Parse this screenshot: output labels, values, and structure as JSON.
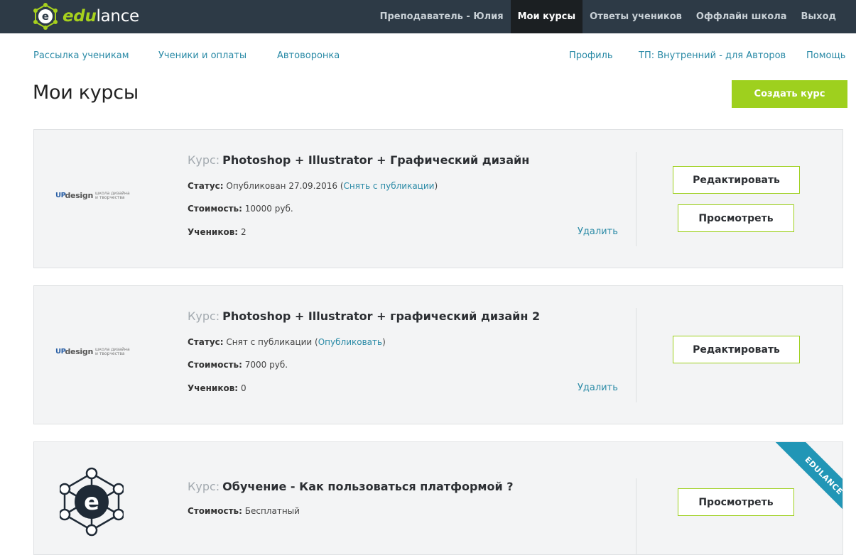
{
  "brand": {
    "logo_part1": "edu",
    "logo_part2": "lance"
  },
  "topnav": {
    "teacher": "Преподаватель - Юлия",
    "my_courses": "Мои курсы",
    "answers": "Ответы учеников",
    "offline": "Оффлайн школа",
    "logout": "Выход"
  },
  "subnav": {
    "mailing": "Рассылка ученикам",
    "students": "Ученики и оплаты",
    "autofunnel": "Автоворонка",
    "profile": "Профиль",
    "tariff": "ТП: Внутренний - для Авторов",
    "help": "Помощь"
  },
  "page": {
    "title": "Мои курсы",
    "create_button": "Создать курс"
  },
  "labels": {
    "course": "Курс:",
    "status": "Статус:",
    "price": "Стоимость:",
    "students": "Учеников:",
    "delete": "Удалить",
    "edit": "Редактировать",
    "view": "Просмотреть"
  },
  "courses": [
    {
      "title": "Photoshop + Illustrator + Графический дизайн",
      "thumb_brand": {
        "up": "UP",
        "design": "design",
        "sub": "школа дизайна и творчества"
      },
      "status_text": "Опубликован 27.09.2016 (",
      "status_link": "Снять с публикации",
      "status_close": ")",
      "price": "10000 руб.",
      "students": "2"
    },
    {
      "title": "Photoshop + Illustrator + графический дизайн 2",
      "thumb_brand": {
        "up": "UP",
        "design": "design",
        "sub": "школа дизайна и творчества"
      },
      "status_text": "Снят с публикации (",
      "status_link": "Опубликовать",
      "status_close": ")",
      "price": "7000 руб.",
      "students": "0"
    },
    {
      "title": "Обучение - Как пользоваться платформой ?",
      "price": "Бесплатный",
      "ribbon": "EDULANCE"
    }
  ],
  "colors": {
    "topbar": "#2d3a46",
    "accent_green": "#9ed01e",
    "link": "#2a8aa6",
    "ribbon": "#2196b6"
  }
}
